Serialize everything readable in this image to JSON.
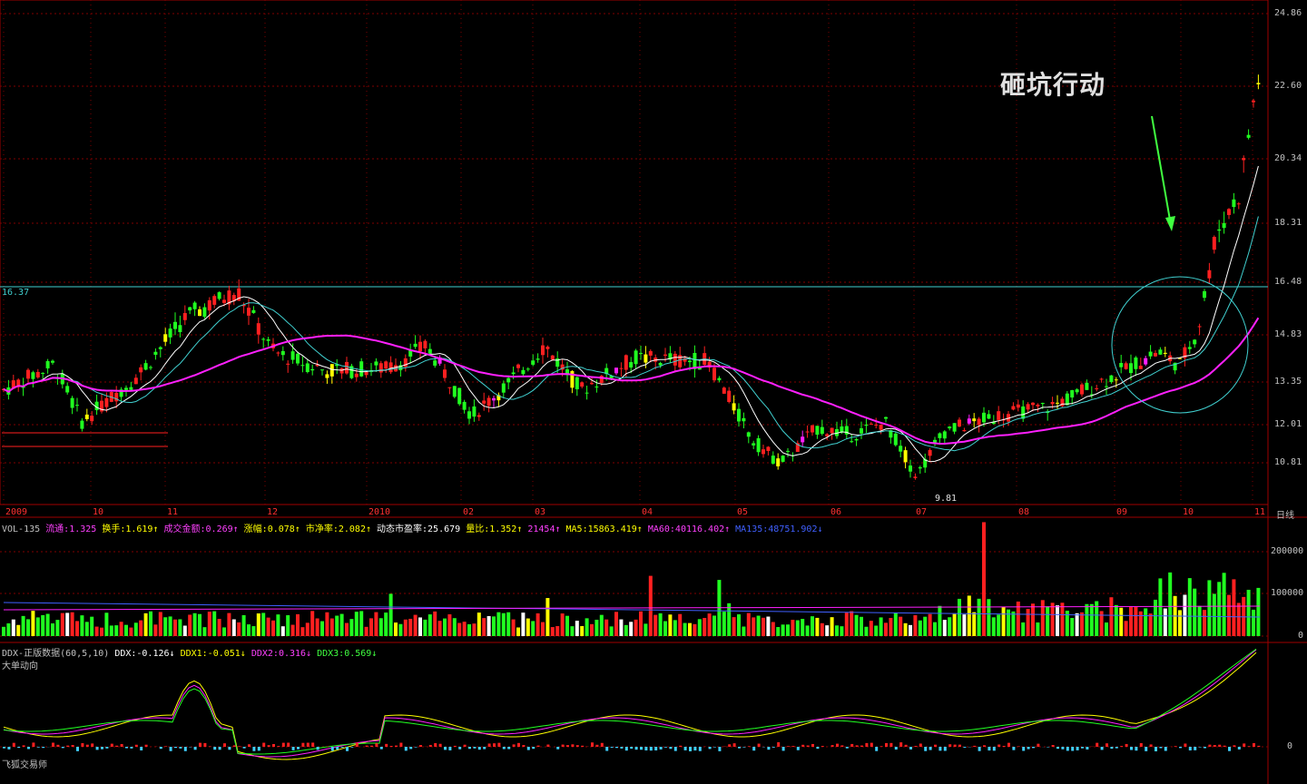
{
  "price": {
    "ticks": [
      {
        "label": "24.86",
        "value": 24.86
      },
      {
        "label": "22.60",
        "value": 22.6
      },
      {
        "label": "20.34",
        "value": 20.34
      },
      {
        "label": "18.31",
        "value": 18.31
      },
      {
        "label": "16.48",
        "value": 16.48
      },
      {
        "label": "14.83",
        "value": 14.83
      },
      {
        "label": "13.35",
        "value": 13.35
      },
      {
        "label": "12.01",
        "value": 12.01
      },
      {
        "label": "10.81",
        "value": 10.81
      }
    ],
    "ref_price": "16.37",
    "low_marker": "9.81",
    "annotation": "砸坑行动"
  },
  "time_axis": {
    "labels": [
      "2009",
      "10",
      "11",
      "12",
      "2010",
      "02",
      "03",
      "04",
      "05",
      "06",
      "07",
      "08",
      "09",
      "10",
      "11"
    ],
    "period": "日线"
  },
  "volume": {
    "name": "VOL-135",
    "fields": [
      {
        "text": "流通:1.325",
        "color": "#ff40ff"
      },
      {
        "text": "换手:1.619↑",
        "color": "#ffff00"
      },
      {
        "text": "成交金额:0.269↑",
        "color": "#ff40ff"
      },
      {
        "text": "涨幅:0.078↑",
        "color": "#ffff00"
      },
      {
        "text": "市净率:2.082↑",
        "color": "#ffff00"
      },
      {
        "text": "动态市盈率:25.679",
        "color": "#ffffff"
      },
      {
        "text": "量比:1.352↑",
        "color": "#ffff00"
      },
      {
        "text": "21454↑",
        "color": "#ff40ff"
      },
      {
        "text": "MA5:15863.419↑",
        "color": "#ffff00"
      },
      {
        "text": "MA60:40116.402↑",
        "color": "#ff40ff"
      },
      {
        "text": "MA135:48751.902↓",
        "color": "#4060ff"
      }
    ],
    "ticks": [
      {
        "label": "200000",
        "value": 200000
      },
      {
        "label": "100000",
        "value": 100000
      },
      {
        "label": "0",
        "value": 0
      }
    ]
  },
  "ddx": {
    "name": "DDX-正版数据(60,5,10)",
    "fields": [
      {
        "text": "DDX:-0.126↓",
        "color": "#ffffff"
      },
      {
        "text": "DDX1:-0.051↓",
        "color": "#ffff00"
      },
      {
        "text": "DDX2:0.316↓",
        "color": "#ff40ff"
      },
      {
        "text": "DDX3:0.569↓",
        "color": "#40ff40"
      }
    ],
    "subtitle": "大单动向",
    "zero_label": "0",
    "footer": "飞狐交易师"
  },
  "colors": {
    "up": "#ff2020",
    "down": "#20ff20",
    "ma_short": "#40d0d0",
    "ma_long": "#ff20ff",
    "grid": "#800000",
    "arrow": "#40ff40"
  }
}
